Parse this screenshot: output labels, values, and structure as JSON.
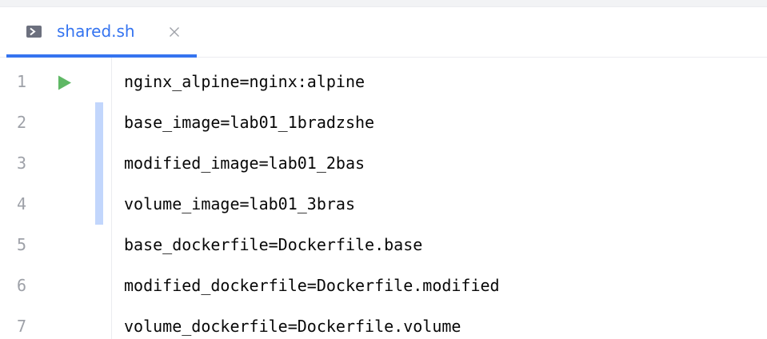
{
  "tab": {
    "filename": "shared.sh",
    "icon": "terminal-script-icon",
    "close_icon": "close-icon",
    "accent_color": "#3574f0"
  },
  "editor": {
    "lines": [
      {
        "number": "1",
        "text": "nginx_alpine=nginx:alpine",
        "run_icon": true,
        "changed": false
      },
      {
        "number": "2",
        "text": "base_image=lab01_1bradzshe",
        "run_icon": false,
        "changed": true
      },
      {
        "number": "3",
        "text": "modified_image=lab01_2bas",
        "run_icon": false,
        "changed": true
      },
      {
        "number": "4",
        "text": "volume_image=lab01_3bras",
        "run_icon": false,
        "changed": true
      },
      {
        "number": "5",
        "text": "base_dockerfile=Dockerfile.base",
        "run_icon": false,
        "changed": false
      },
      {
        "number": "6",
        "text": "modified_dockerfile=Dockerfile.modified",
        "run_icon": false,
        "changed": false
      },
      {
        "number": "7",
        "text": "volume_dockerfile=Dockerfile.volume",
        "run_icon": false,
        "changed": false
      }
    ],
    "run_icon_color": "#5fb865",
    "change_marker_color": "#c2d6fc"
  }
}
